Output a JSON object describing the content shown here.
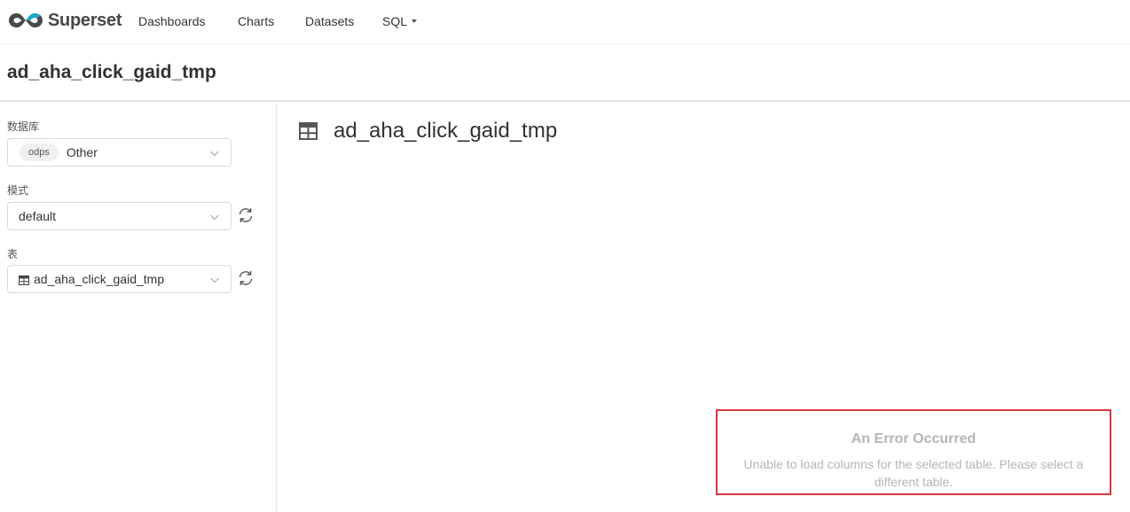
{
  "brand": {
    "name": "Superset",
    "color": "#20a7c9"
  },
  "nav": {
    "items": [
      {
        "label": "Dashboards"
      },
      {
        "label": "Charts"
      },
      {
        "label": "Datasets"
      },
      {
        "label": "SQL"
      }
    ]
  },
  "page": {
    "title": "ad_aha_click_gaid_tmp"
  },
  "sidebar": {
    "database": {
      "label": "数据库",
      "tag": "odps",
      "value": "Other",
      "icon": "chevron-down-icon"
    },
    "schema": {
      "label": "模式",
      "value": "default",
      "icon": "chevron-down-icon",
      "refresh_icon": "refresh-icon"
    },
    "table": {
      "label": "表",
      "value": "ad_aha_click_gaid_tmp",
      "type_icon": "table-icon",
      "icon": "chevron-down-icon",
      "refresh_icon": "refresh-icon"
    }
  },
  "main": {
    "title": "ad_aha_click_gaid_tmp",
    "title_icon": "table-icon"
  },
  "error": {
    "title": "An Error Occurred",
    "message": "Unable to load columns for the selected table. Please select a different table.",
    "border_color": "#d9363e"
  }
}
